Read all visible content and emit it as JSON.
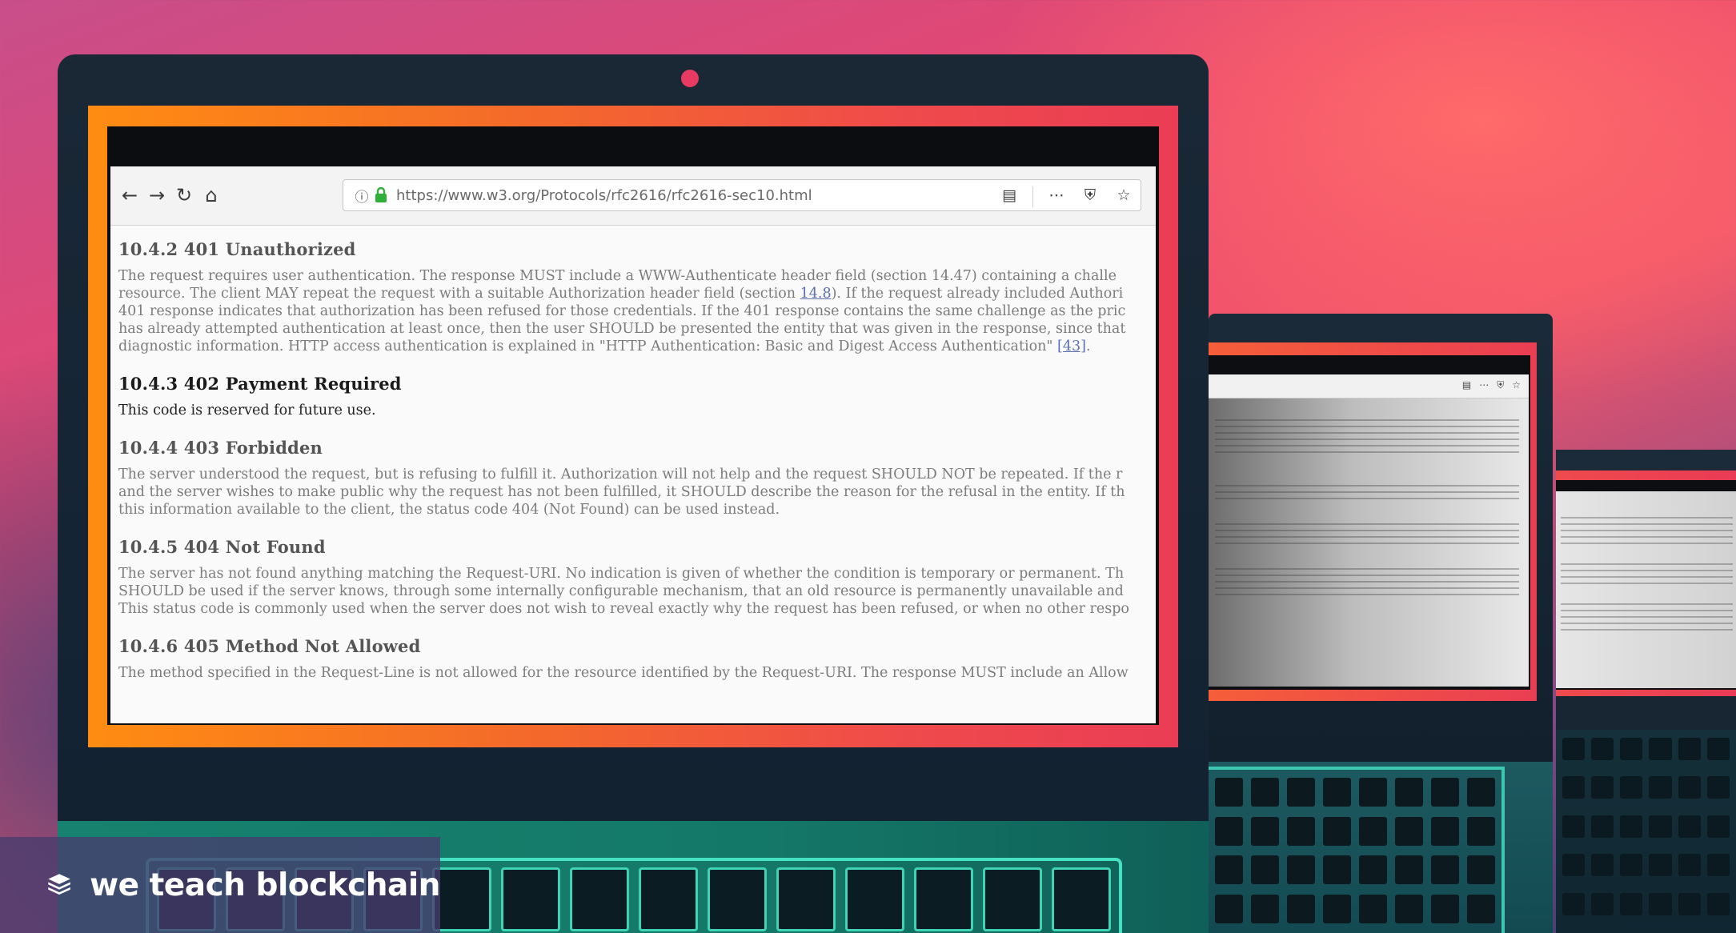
{
  "browser": {
    "url_host": "https://www.w3.org",
    "url_path": "/Protocols/rfc2616/rfc2616-sec10.html"
  },
  "sections": [
    {
      "title": "10.4.2 401 Unauthorized",
      "lines": [
        "The request requires user authentication. The response MUST include a WWW-Authenticate header field (section 14.47) containing a challe",
        "resource. The client MAY repeat the request with a suitable Authorization header field (section ",
        "401 response indicates that authorization has been refused for those credentials. If the 401 response contains the same challenge as the pric",
        "has already attempted authentication at least once, then the user SHOULD be presented the entity that was given in the response, since that",
        "diagnostic information. HTTP access authentication is explained in \"HTTP Authentication: Basic and Digest Access Authentication\" "
      ],
      "link_1": "14.8",
      "line_2_tail": "). If the request already included Authori",
      "link_2": "[43]",
      "line_5_tail": "."
    },
    {
      "title": "10.4.3 402 Payment Required",
      "lines": [
        "This code is reserved for future use."
      ]
    },
    {
      "title": "10.4.4 403 Forbidden",
      "lines": [
        "The server understood the request, but is refusing to fulfill it. Authorization will not help and the request SHOULD NOT be repeated. If the r",
        "and the server wishes to make public why the request has not been fulfilled, it SHOULD describe the reason for the refusal in the entity. If th",
        "this information available to the client, the status code 404 (Not Found) can be used instead."
      ]
    },
    {
      "title": "10.4.5 404 Not Found",
      "lines": [
        "The server has not found anything matching the Request-URI. No indication is given of whether the condition is temporary or permanent. Th",
        "SHOULD be used if the server knows, through some internally configurable mechanism, that an old resource is permanently unavailable and",
        "This status code is commonly used when the server does not wish to reveal exactly why the request has been refused, or when no other respo"
      ]
    },
    {
      "title": "10.4.6 405 Method Not Allowed",
      "lines": [
        "The method specified in the Request-Line is not allowed for the resource identified by the Request-URI. The response MUST include an Allow"
      ]
    }
  ],
  "brand": {
    "name": "we teach blockchain"
  },
  "colors": {
    "accent_orange": "#ff8c12",
    "accent_red": "#ea3d55",
    "keyboard_teal": "#46e0c2",
    "link": "#5a6fb4"
  },
  "icons": {
    "back": "arrow-left-icon",
    "forward": "arrow-right-icon",
    "reload": "reload-icon",
    "home": "home-icon",
    "info": "info-icon",
    "lock": "lock-icon",
    "reader": "reader-view-icon",
    "more": "more-icon",
    "pocket": "pocket-icon",
    "bookmark": "star-icon",
    "logo": "stacked-blocks-icon"
  }
}
